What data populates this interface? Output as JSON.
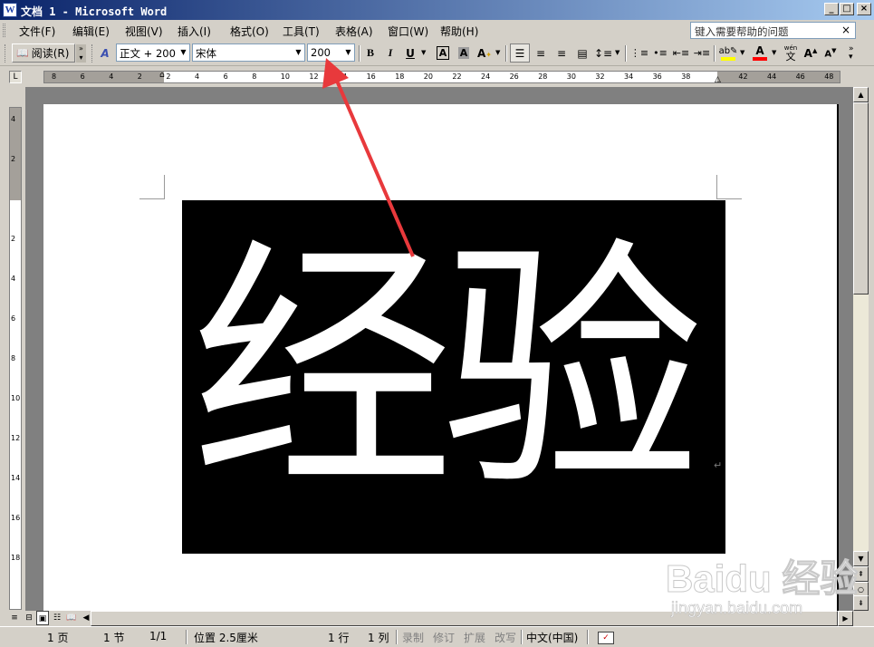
{
  "window": {
    "title": "文档 1 - Microsoft Word",
    "minimize_glyph": "_",
    "maximize_glyph": "□",
    "close_glyph": "×"
  },
  "menubar": {
    "items": [
      {
        "label": "文件(F)"
      },
      {
        "label": "编辑(E)"
      },
      {
        "label": "视图(V)"
      },
      {
        "label": "插入(I)"
      },
      {
        "label": "格式(O)"
      },
      {
        "label": "工具(T)"
      },
      {
        "label": "表格(A)"
      },
      {
        "label": "窗口(W)"
      },
      {
        "label": "帮助(H)"
      }
    ],
    "help_placeholder": "键入需要帮助的问题",
    "close_glyph": "×"
  },
  "toolbar": {
    "read_label": "阅读(R)",
    "style_icon": "A",
    "style_value": "正文 + 200",
    "font_value": "宋体",
    "size_value": "200",
    "bold": "B",
    "italic": "I",
    "underline": "U",
    "char_border": "A",
    "char_shading": "A",
    "grow_font": "A",
    "shrink_font": "A",
    "font_color": "A",
    "phonetic": "wén",
    "phonetic_char": "文"
  },
  "ruler": {
    "h_numbers": [
      "8",
      "6",
      "4",
      "2",
      "2",
      "4",
      "6",
      "8",
      "10",
      "12",
      "14",
      "16",
      "18",
      "20",
      "22",
      "24",
      "26",
      "28",
      "30",
      "32",
      "34",
      "36",
      "38",
      "42",
      "44",
      "46",
      "48"
    ],
    "v_numbers": [
      "4",
      "2",
      "2",
      "4",
      "6",
      "8",
      "10",
      "12",
      "14",
      "16",
      "18"
    ],
    "corner_glyph": "L"
  },
  "document": {
    "text": "经验",
    "paragraph_mark": "↵"
  },
  "status": {
    "page": "1 页",
    "section": "1 节",
    "page_of": "1/1",
    "position": "位置 2.5厘米",
    "line": "1 行",
    "column": "1 列",
    "rec": "录制",
    "trk": "修订",
    "ext": "扩展",
    "ovr": "改写",
    "language": "中文(中国)"
  },
  "watermark": {
    "main": "Baidu 经验",
    "sub": "jingyan.baidu.com"
  },
  "colors": {
    "title_gradient_start": "#0a246a",
    "title_gradient_end": "#a6caf0",
    "annotation_arrow": "#e8393c",
    "font_color_bar": "#ff0000",
    "highlight_bar": "#ffff00"
  }
}
